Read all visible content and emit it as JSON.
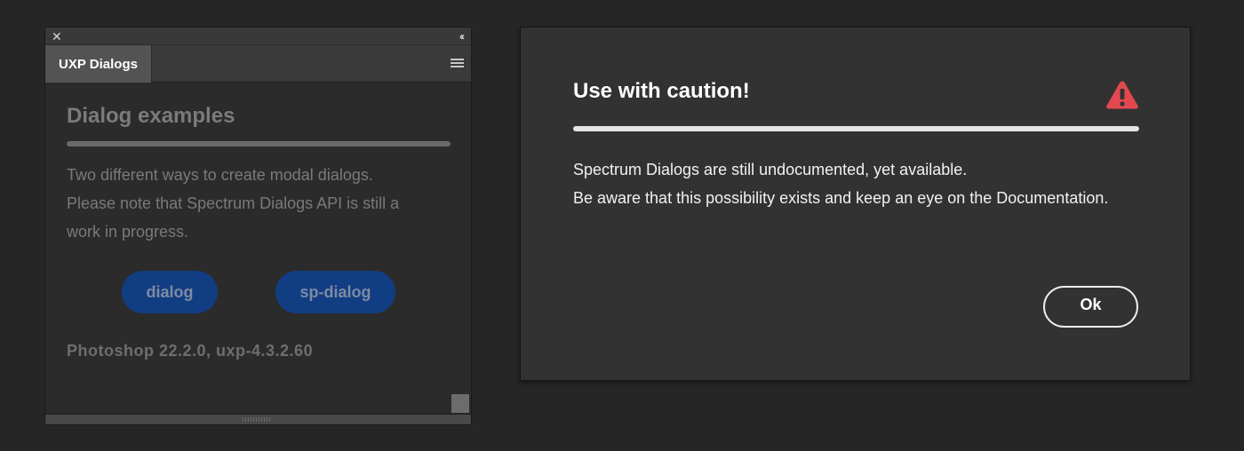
{
  "panel": {
    "close_glyph": "✕",
    "collapse_glyph": "‹‹",
    "tab_label": "UXP Dialogs",
    "menu_icon": "hamburger-icon",
    "heading": "Dialog examples",
    "description_lines": [
      "Two different ways to create modal dialogs.",
      "Please note that Spectrum Dialogs API is still a",
      "work in progress."
    ],
    "buttons": {
      "dialog": "dialog",
      "sp_dialog": "sp-dialog"
    },
    "version": "Photoshop 22.2.0, uxp-4.3.2.60"
  },
  "dialog": {
    "title": "Use with caution!",
    "icon": "alert-triangle-icon",
    "body_lines": [
      "Spectrum Dialogs are still undocumented, yet available.",
      "Be aware that this possibility exists and keep an eye on the Documentation."
    ],
    "ok_label": "Ok"
  },
  "colors": {
    "background": "#262626",
    "panel": "#323232",
    "accent_blue": "#113d83",
    "alert_red": "#e34850"
  }
}
